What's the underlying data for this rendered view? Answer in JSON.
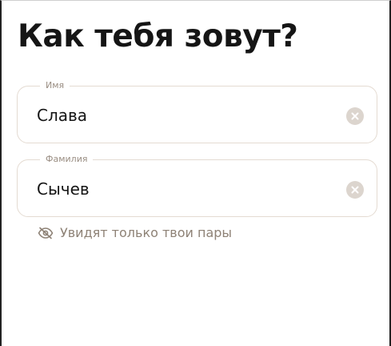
{
  "title": "Как тебя зовут?",
  "first_name": {
    "label": "Имя",
    "value": "Слава",
    "clear_icon": "clear-circle-icon"
  },
  "last_name": {
    "label": "Фамилия",
    "value": "Сычев",
    "clear_icon": "clear-circle-icon"
  },
  "hint": {
    "icon": "eye-off-icon",
    "text": "Увидят только твои пары"
  },
  "colors": {
    "text": "#151515",
    "field_border": "#e4dbd2",
    "label": "#9a8e83",
    "clear_bg": "#dcd5ce",
    "hint": "#8e8276"
  }
}
